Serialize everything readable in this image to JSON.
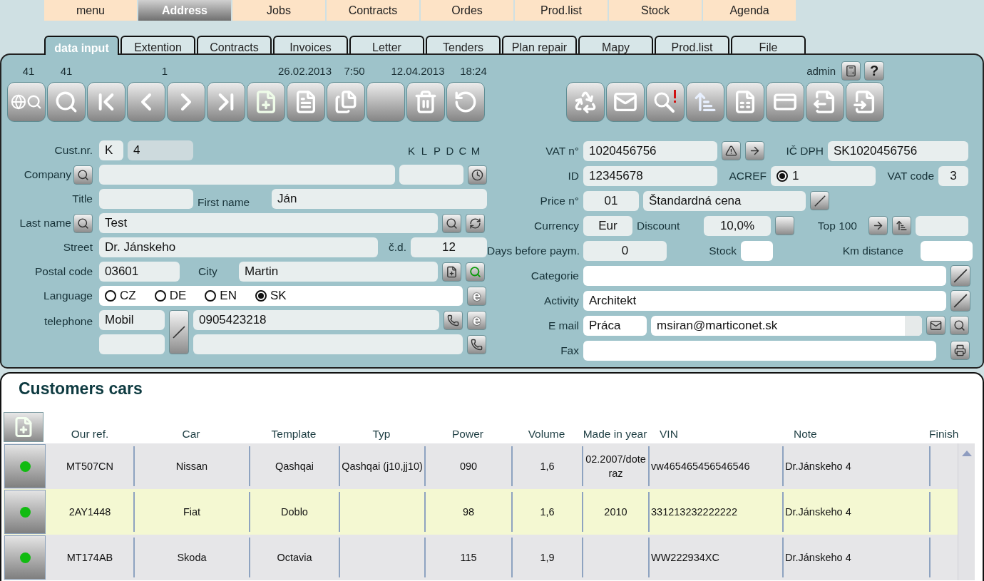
{
  "top_menu": [
    {
      "label": "menu",
      "selected": false
    },
    {
      "label": "Address",
      "selected": true
    },
    {
      "label": "Jobs",
      "selected": false
    },
    {
      "label": "Contracts",
      "selected": false
    },
    {
      "label": "Ordes",
      "selected": false
    },
    {
      "label": "Prod.list",
      "selected": false
    },
    {
      "label": "Stock",
      "selected": false
    },
    {
      "label": "Agenda",
      "selected": false
    }
  ],
  "sub_tabs": [
    {
      "label": "data input",
      "selected": true
    },
    {
      "label": "Extention",
      "selected": false
    },
    {
      "label": "Contracts",
      "selected": false
    },
    {
      "label": "Invoices",
      "selected": false
    },
    {
      "label": "Letter",
      "selected": false
    },
    {
      "label": "Tenders",
      "selected": false
    },
    {
      "label": "Plan repair",
      "selected": false
    },
    {
      "label": "Mapy",
      "selected": false
    },
    {
      "label": "Prod.list",
      "selected": false
    },
    {
      "label": "File",
      "selected": false
    }
  ],
  "info_bar": {
    "counters": [
      "41",
      "41",
      "1"
    ],
    "created": {
      "date": "26.02.2013",
      "time": "7:50"
    },
    "modified": {
      "date": "12.04.2013",
      "time": "18:24"
    },
    "user": "admin",
    "help": "?"
  },
  "left_form": {
    "cust_nr": {
      "label": "Cust.nr.",
      "prefix": "K",
      "value": "4"
    },
    "flags": [
      "K",
      "L",
      "P",
      "D",
      "C",
      "M"
    ],
    "company": {
      "label": "Company"
    },
    "title": {
      "label": "Title"
    },
    "first_name": {
      "label": "First name",
      "value": "Ján"
    },
    "last_name": {
      "label": "Last name",
      "value": "Test"
    },
    "street": {
      "label": "Street",
      "value": "Dr. Jánskeho"
    },
    "house_no": {
      "label": "č.d.",
      "value": "12"
    },
    "postal_code": {
      "label": "Postal code",
      "value": "03601"
    },
    "city": {
      "label": "City",
      "value": "Martin"
    },
    "language": {
      "label": "Language",
      "button": "e",
      "options": [
        {
          "label": "CZ",
          "selected": false
        },
        {
          "label": "DE",
          "selected": false
        },
        {
          "label": "EN",
          "selected": false
        },
        {
          "label": "SK",
          "selected": true
        }
      ]
    },
    "telephone": {
      "label": "telephone",
      "type": "Mobil",
      "number": "0905423218",
      "button": "e"
    }
  },
  "right_form": {
    "vat_no": {
      "label": "VAT n°",
      "value": "1020456756"
    },
    "ic_dph": {
      "label": "IČ DPH",
      "value": "SK1020456756"
    },
    "id": {
      "label": "ID",
      "value": "12345678"
    },
    "acref": {
      "label": "ACREF",
      "value": "1",
      "checked": true
    },
    "vat_code": {
      "label": "VAT code",
      "value": "3"
    },
    "price_no": {
      "label": "Price n°",
      "value": "01",
      "name": "Štandardná cena"
    },
    "currency": {
      "label": "Currency",
      "value": "Eur"
    },
    "discount": {
      "label": "Discount",
      "value": "10,0%"
    },
    "top100": {
      "label": "Top 100"
    },
    "days": {
      "label": "Days before paym.",
      "value": "0"
    },
    "stock": {
      "label": "Stock"
    },
    "km": {
      "label": "Km distance"
    },
    "categorie": {
      "label": "Categorie"
    },
    "activity": {
      "label": "Activity",
      "value": "Architekt"
    },
    "email": {
      "label": "E mail",
      "type": "Práca",
      "value": "msiran@marticonet.sk"
    },
    "fax": {
      "label": "Fax"
    }
  },
  "cars": {
    "title": "Customers cars",
    "columns": [
      "Our ref.",
      "Car",
      "Template",
      "Typ",
      "Power",
      "Volume",
      "Made in year",
      "VIN",
      "Note",
      "Finish"
    ],
    "rows": [
      {
        "selected": false,
        "color": "#11bb11",
        "our_ref": "MT507CN",
        "car": "Nissan",
        "template": "Qashqai",
        "typ": "Qashqai (j10,jj10)",
        "power": "090",
        "volume": "1,6",
        "made": "02.2007/doteraz",
        "vin": "vw465465456546546",
        "note": "Dr.Jánskeho 4"
      },
      {
        "selected": true,
        "color": "#11bb11",
        "our_ref": "2AY1448",
        "car": "Fiat",
        "template": "Doblo",
        "power": "98",
        "volume": "1,6",
        "made": "2010",
        "vin": "331213232222222",
        "note": "Dr.Jánskeho 4"
      },
      {
        "selected": false,
        "color": "#11bb11",
        "our_ref": "MT174AB",
        "car": "Skoda",
        "template": "Octavia",
        "power": "115",
        "volume": "1,9",
        "vin": "WW222934XC",
        "note": "Dr.Jánskeho 4"
      }
    ]
  }
}
